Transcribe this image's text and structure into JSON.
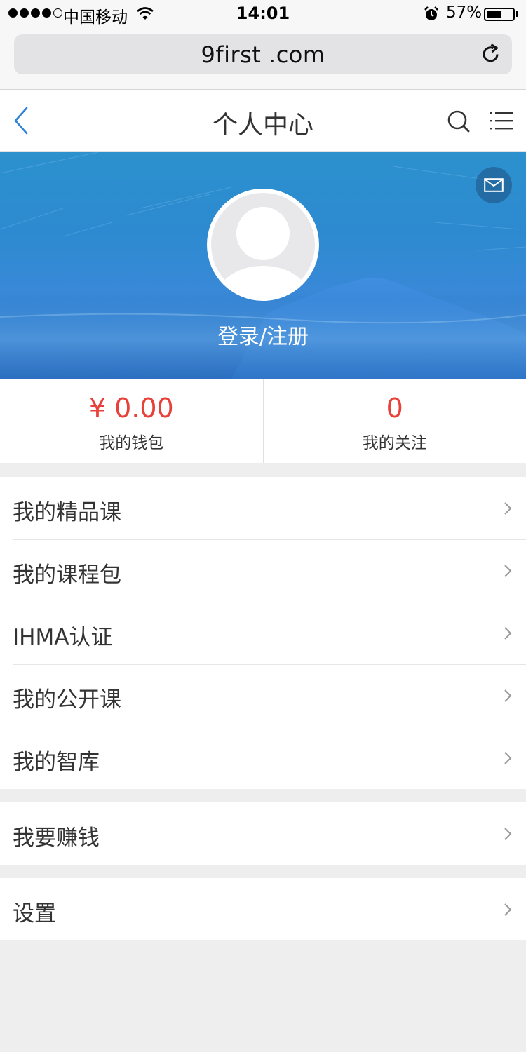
{
  "status_bar": {
    "carrier": "中国移动",
    "time": "14:01",
    "battery_percent": "57%",
    "battery_level": 0.57,
    "signal_bars_filled": 4,
    "signal_bars_total": 5
  },
  "browser": {
    "url": "9first .com"
  },
  "header": {
    "title": "个人中心"
  },
  "profile": {
    "login_label": "登录/注册"
  },
  "stats": [
    {
      "value": "¥ 0.00",
      "label": "我的钱包"
    },
    {
      "value": "0",
      "label": "我的关注"
    }
  ],
  "menu_groups": [
    {
      "items": [
        {
          "label": "我的精品课"
        },
        {
          "label": "我的课程包"
        },
        {
          "label": "IHMA认证"
        },
        {
          "label": "我的公开课"
        },
        {
          "label": "我的智库"
        }
      ]
    },
    {
      "items": [
        {
          "label": "我要赚钱"
        }
      ]
    },
    {
      "items": [
        {
          "label": "设置"
        }
      ]
    }
  ],
  "icons": {
    "back": "chevron-left-icon",
    "search": "search-icon",
    "menu": "list-menu-icon",
    "mail": "mail-icon",
    "reload": "reload-icon",
    "item_arrow": "chevron-right-icon"
  },
  "colors": {
    "accent_blue": "#2b82d6",
    "price_red": "#e8413a",
    "hero_blue": "#2d8ad0"
  }
}
